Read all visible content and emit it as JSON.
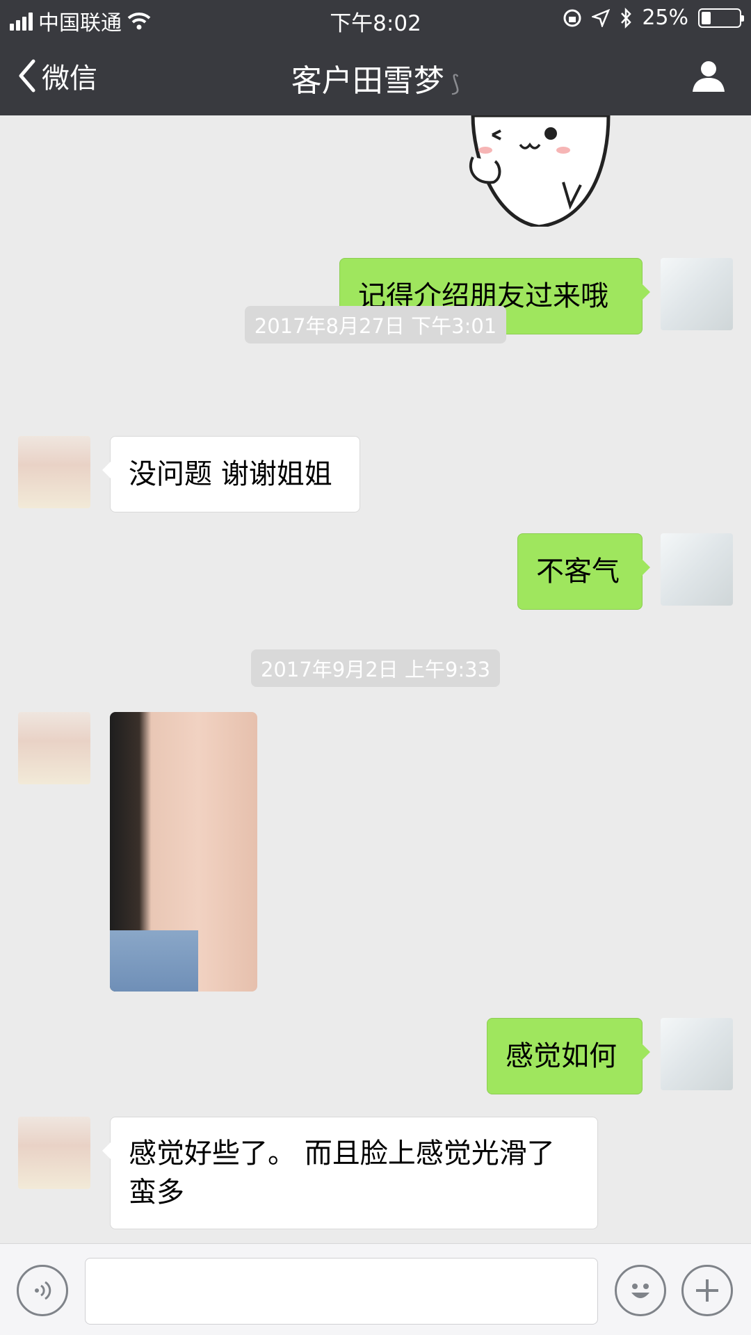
{
  "status_bar": {
    "carrier": "中国联通",
    "time": "下午8:02",
    "battery_percent": "25%",
    "battery_level": 0.25
  },
  "nav": {
    "back_label": "微信",
    "title": "客户田雪梦"
  },
  "messages": [
    {
      "type": "sticker",
      "side": "out"
    },
    {
      "type": "text",
      "side": "out",
      "text": "记得介绍朋友过来哦"
    },
    {
      "type": "timestamp",
      "text": "2017年8月27日 下午3:01"
    },
    {
      "type": "text",
      "side": "in",
      "text": "没问题 谢谢姐姐"
    },
    {
      "type": "text",
      "side": "out",
      "text": "不客气"
    },
    {
      "type": "timestamp",
      "text": "2017年9月2日 上午9:33"
    },
    {
      "type": "image",
      "side": "in"
    },
    {
      "type": "text",
      "side": "out",
      "text": "感觉如何"
    },
    {
      "type": "text",
      "side": "in",
      "text": "感觉好些了。 而且脸上感觉光滑了蛮多"
    }
  ],
  "icons": {
    "back": "chevron-left-icon",
    "ear": "ear-icon",
    "profile": "person-icon",
    "voice": "voice-icon",
    "emoji": "emoji-icon",
    "plus": "plus-icon"
  },
  "colors": {
    "nav_bg": "#393a3f",
    "chat_bg": "#ebebeb",
    "out_bubble": "#9fe65e",
    "in_bubble": "#ffffff"
  }
}
